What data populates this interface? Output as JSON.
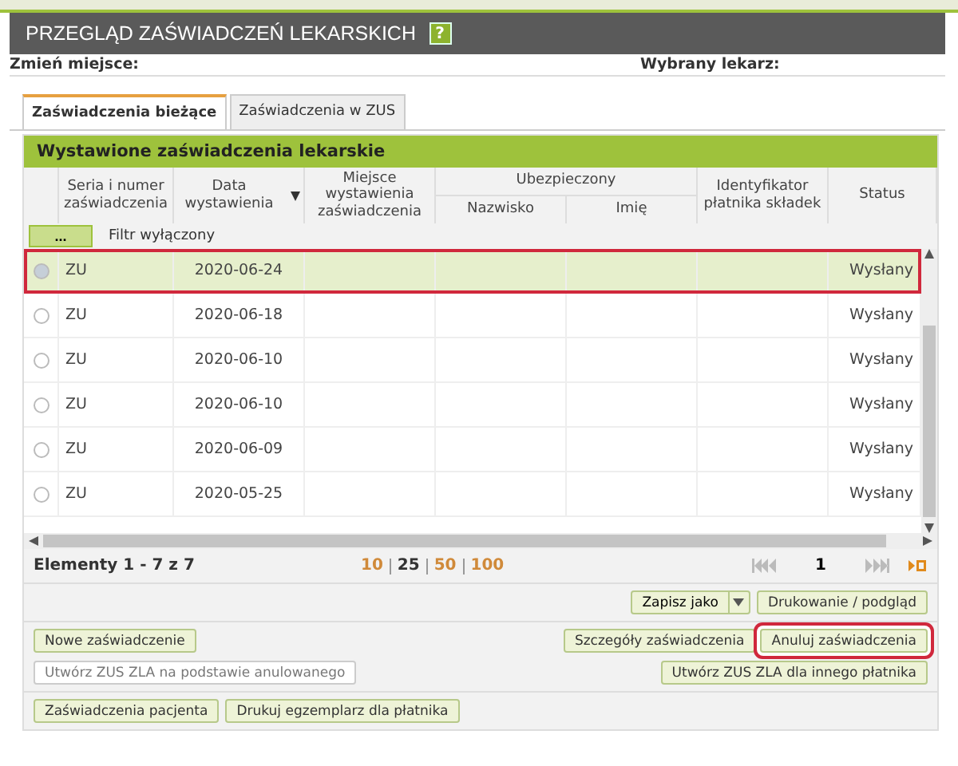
{
  "title": "PRZEGLĄD ZAŚWIADCZEŃ LEKARSKICH",
  "help_icon": "?",
  "place_label": "Zmień miejsce:",
  "doctor_label": "Wybrany lekarz:",
  "tabs": [
    {
      "label": "Zaświadczenia bieżące",
      "selected": true
    },
    {
      "label": "Zaświadczenia w ZUS",
      "selected": false
    }
  ],
  "section_title": "Wystawione zaświadczenia lekarskie",
  "columns": {
    "series": "Seria i numer zaświadczenia",
    "date": "Data wystawienia",
    "place": "Miejsce wystawienia zaświadczenia",
    "insured": "Ubezpieczony",
    "surname": "Nazwisko",
    "name": "Imię",
    "payer": "Identyfikator płatnika składek",
    "status": "Status"
  },
  "filter": {
    "button": "...",
    "label": "Filtr wyłączony"
  },
  "rows": [
    {
      "series": "ZU",
      "date": "2020-06-24",
      "status": "Wysłany",
      "selected": true,
      "highlighted": true
    },
    {
      "series": "ZU",
      "date": "2020-06-18",
      "status": "Wysłany",
      "selected": false,
      "highlighted": false
    },
    {
      "series": "ZU",
      "date": "2020-06-10",
      "status": "Wysłany",
      "selected": false,
      "highlighted": false
    },
    {
      "series": "ZU",
      "date": "2020-06-10",
      "status": "Wysłany",
      "selected": false,
      "highlighted": false
    },
    {
      "series": "ZU",
      "date": "2020-06-09",
      "status": "Wysłany",
      "selected": false,
      "highlighted": false
    },
    {
      "series": "ZU",
      "date": "2020-05-25",
      "status": "Wysłany",
      "selected": false,
      "highlighted": false
    }
  ],
  "pager": {
    "summary": "Elementy 1 - 7 z 7",
    "sizes": [
      {
        "label": "10",
        "selected": false
      },
      {
        "label": "25",
        "selected": true
      },
      {
        "label": "50",
        "selected": false
      },
      {
        "label": "100",
        "selected": false
      }
    ],
    "page": "1"
  },
  "export_buttons": [
    {
      "label": "Zapisz jako",
      "kind": "split"
    },
    {
      "label": "Drukowanie / podgląd",
      "kind": "plain"
    }
  ],
  "actions_left": [
    {
      "label": "Nowe zaświadczenie",
      "disabled": false,
      "highlighted": false
    },
    {
      "label": "Utwórz ZUS ZLA na podstawie anulowanego",
      "disabled": true,
      "highlighted": false
    }
  ],
  "actions_right": [
    {
      "label": "Szczegóły zaświadczenia",
      "disabled": false,
      "highlighted": false
    },
    {
      "label": "Anuluj zaświadczenia",
      "disabled": false,
      "highlighted": true
    },
    {
      "label": "Utwórz ZUS ZLA dla innego płatnika",
      "disabled": false,
      "highlighted": false
    }
  ],
  "bottom_buttons": [
    {
      "label": "Zaświadczenia pacjenta"
    },
    {
      "label": "Drukuj egzemplarz dla płatnika"
    }
  ]
}
